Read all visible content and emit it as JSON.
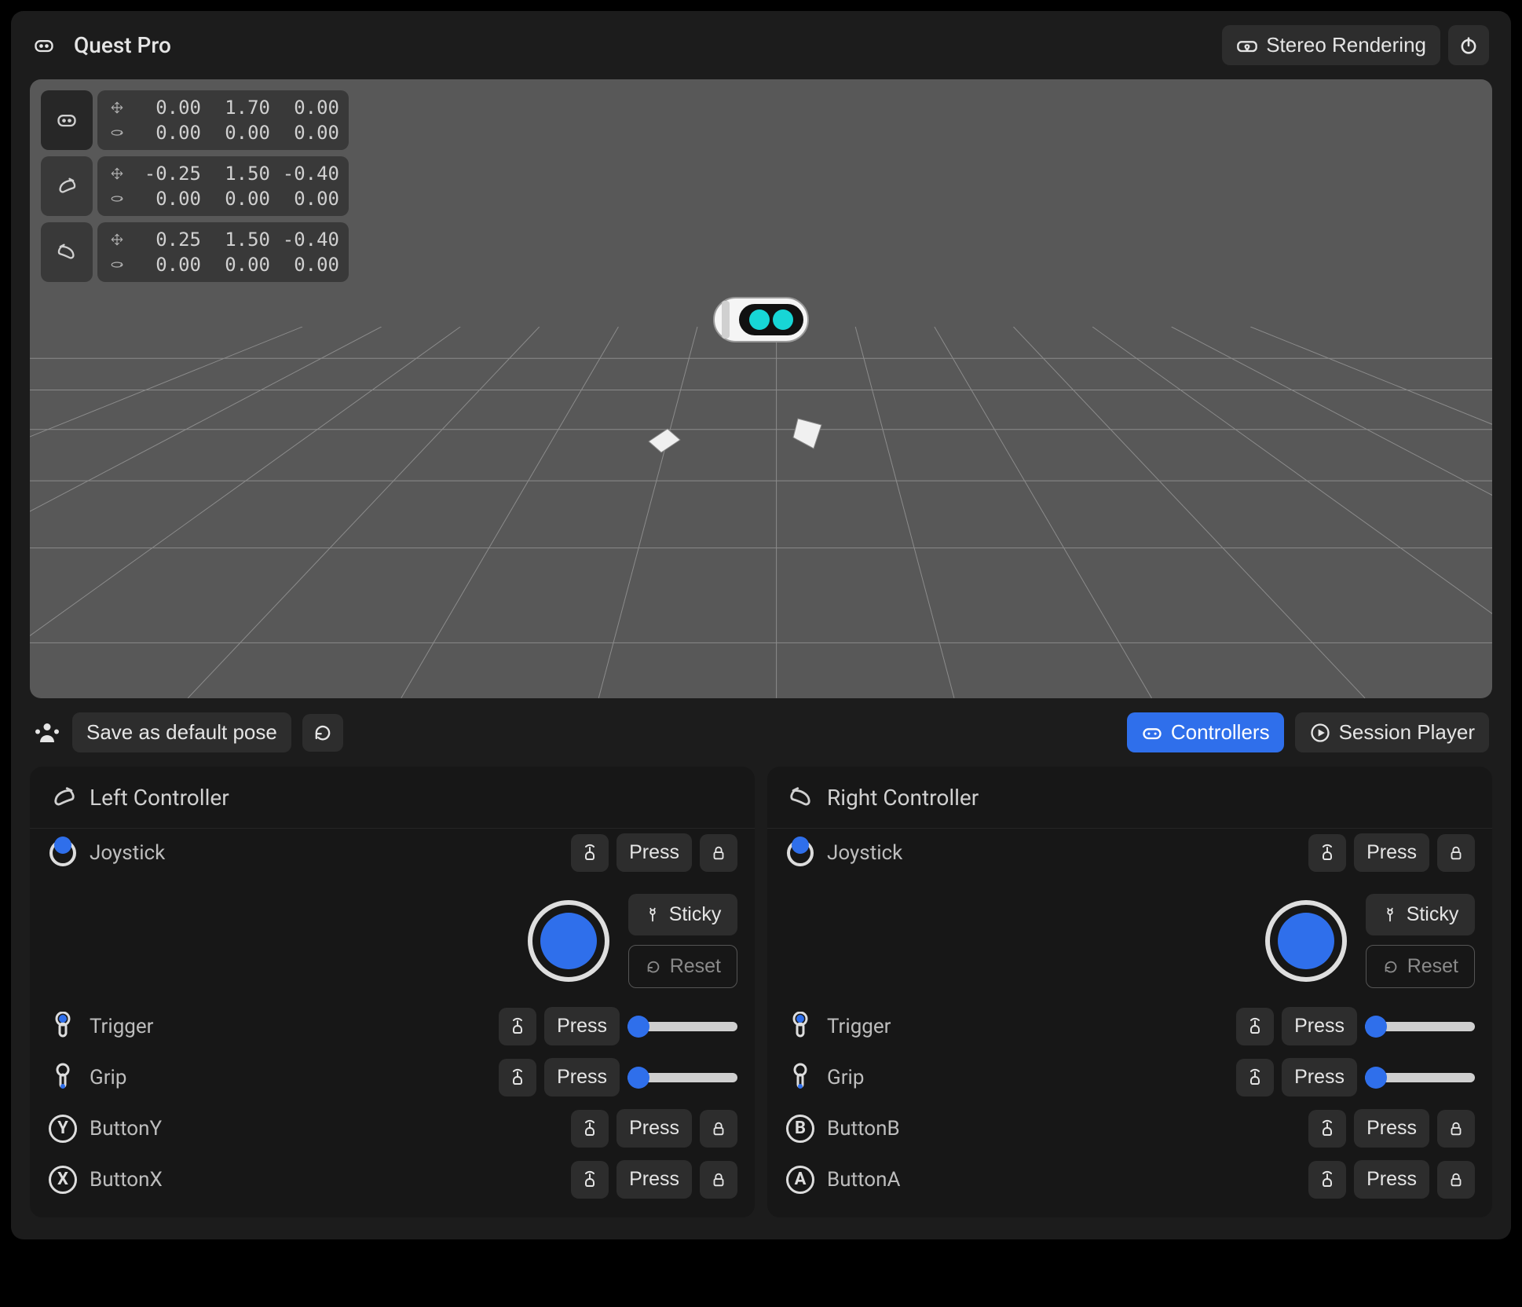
{
  "header": {
    "title": "Quest Pro",
    "stereo_label": "Stereo Rendering"
  },
  "overlay": {
    "headset": {
      "pos": [
        "0.00",
        "1.70",
        "0.00"
      ],
      "rot": [
        "0.00",
        "0.00",
        "0.00"
      ]
    },
    "left": {
      "pos": [
        "-0.25",
        "1.50",
        "-0.40"
      ],
      "rot": [
        "0.00",
        "0.00",
        "0.00"
      ]
    },
    "right": {
      "pos": [
        "0.25",
        "1.50",
        "-0.40"
      ],
      "rot": [
        "0.00",
        "0.00",
        "0.00"
      ]
    }
  },
  "toolbar": {
    "save_label": "Save as default pose",
    "controllers_label": "Controllers",
    "session_player_label": "Session Player"
  },
  "panel_left": {
    "title": "Left Controller",
    "joystick_label": "Joystick",
    "trigger_label": "Trigger",
    "grip_label": "Grip",
    "buttonA_label": "ButtonY",
    "buttonA_letter": "Y",
    "buttonB_label": "ButtonX",
    "buttonB_letter": "X"
  },
  "panel_right": {
    "title": "Right Controller",
    "joystick_label": "Joystick",
    "trigger_label": "Trigger",
    "grip_label": "Grip",
    "buttonA_label": "ButtonB",
    "buttonA_letter": "B",
    "buttonB_label": "ButtonA",
    "buttonB_letter": "A"
  },
  "common": {
    "press_label": "Press",
    "sticky_label": "Sticky",
    "reset_label": "Reset",
    "trigger_value": 0,
    "grip_value": 0
  }
}
